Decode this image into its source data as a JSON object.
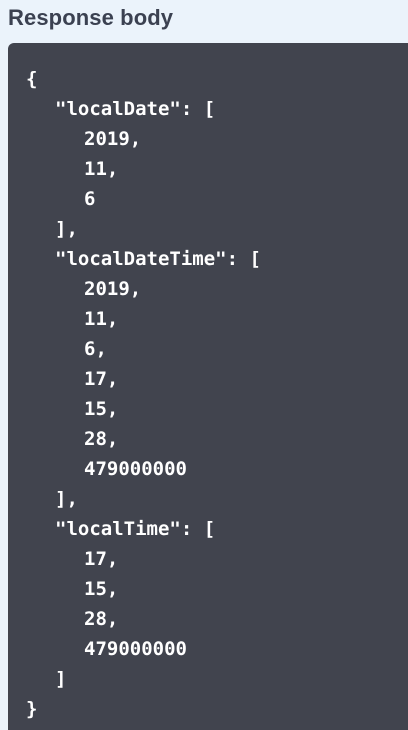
{
  "title": "Response body",
  "colors": {
    "page_background": "#ebf3fb",
    "panel_background": "#41444e",
    "title_text": "#3b4151",
    "code_text": "#ffffff"
  },
  "response_lines": [
    {
      "indent": 0,
      "text": "{"
    },
    {
      "indent": 1,
      "text": "\"localDate\": ["
    },
    {
      "indent": 2,
      "text": "2019,"
    },
    {
      "indent": 2,
      "text": "11,"
    },
    {
      "indent": 2,
      "text": "6"
    },
    {
      "indent": 1,
      "text": "],"
    },
    {
      "indent": 1,
      "text": "\"localDateTime\": ["
    },
    {
      "indent": 2,
      "text": "2019,"
    },
    {
      "indent": 2,
      "text": "11,"
    },
    {
      "indent": 2,
      "text": "6,"
    },
    {
      "indent": 2,
      "text": "17,"
    },
    {
      "indent": 2,
      "text": "15,"
    },
    {
      "indent": 2,
      "text": "28,"
    },
    {
      "indent": 2,
      "text": "479000000"
    },
    {
      "indent": 1,
      "text": "],"
    },
    {
      "indent": 1,
      "text": "\"localTime\": ["
    },
    {
      "indent": 2,
      "text": "17,"
    },
    {
      "indent": 2,
      "text": "15,"
    },
    {
      "indent": 2,
      "text": "28,"
    },
    {
      "indent": 2,
      "text": "479000000"
    },
    {
      "indent": 1,
      "text": "]"
    },
    {
      "indent": 0,
      "text": "}"
    }
  ]
}
